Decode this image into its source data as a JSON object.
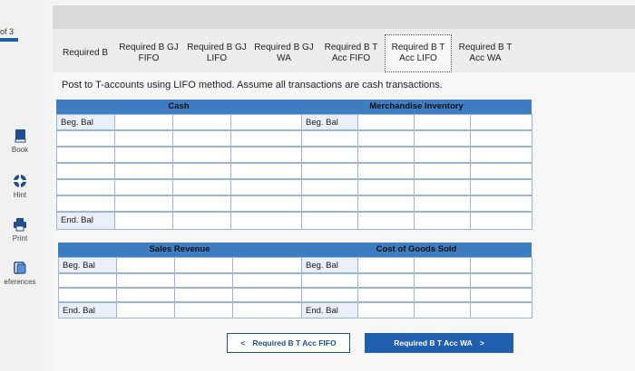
{
  "sidebar": {
    "page_count": "of 3",
    "items": [
      {
        "label": "Book",
        "icon": "book-icon"
      },
      {
        "label": "Hint",
        "icon": "lifebuoy-icon"
      },
      {
        "label": "Print",
        "icon": "printer-icon"
      },
      {
        "label": "eferences",
        "icon": "references-icon"
      }
    ]
  },
  "tabs": [
    {
      "label": "Required B",
      "active": false
    },
    {
      "label": "Required B GJ FIFO",
      "active": false
    },
    {
      "label": "Required B GJ LIFO",
      "active": false
    },
    {
      "label": "Required B GJ WA",
      "active": false
    },
    {
      "label": "Required B T Acc FIFO",
      "active": false
    },
    {
      "label": "Required B T Acc LIFO",
      "active": true
    },
    {
      "label": "Required B T Acc WA",
      "active": false
    }
  ],
  "instruction": "Post to T-accounts using LIFO method. Assume all transactions are cash transactions.",
  "accounts": {
    "cash": {
      "title": "Cash",
      "beg_label": "Beg. Bal",
      "end_label": "End. Bal"
    },
    "merch": {
      "title": "Merchandise Inventory",
      "beg_label": "Beg. Bal"
    },
    "sales": {
      "title": "Sales Revenue",
      "beg_label": "Beg. Bal",
      "end_label": "End. Bal"
    },
    "cogs": {
      "title": "Cost of Goods Sold",
      "beg_label": "Beg. Bal",
      "end_label": "End. Bal"
    }
  },
  "nav": {
    "prev_label": "Required B T Acc FIFO",
    "prev_arrow": "<",
    "next_label": "Required B T Acc WA",
    "next_arrow": ">"
  },
  "colors": {
    "accent": "#3e7dc1",
    "nav": "#1f5fad"
  }
}
